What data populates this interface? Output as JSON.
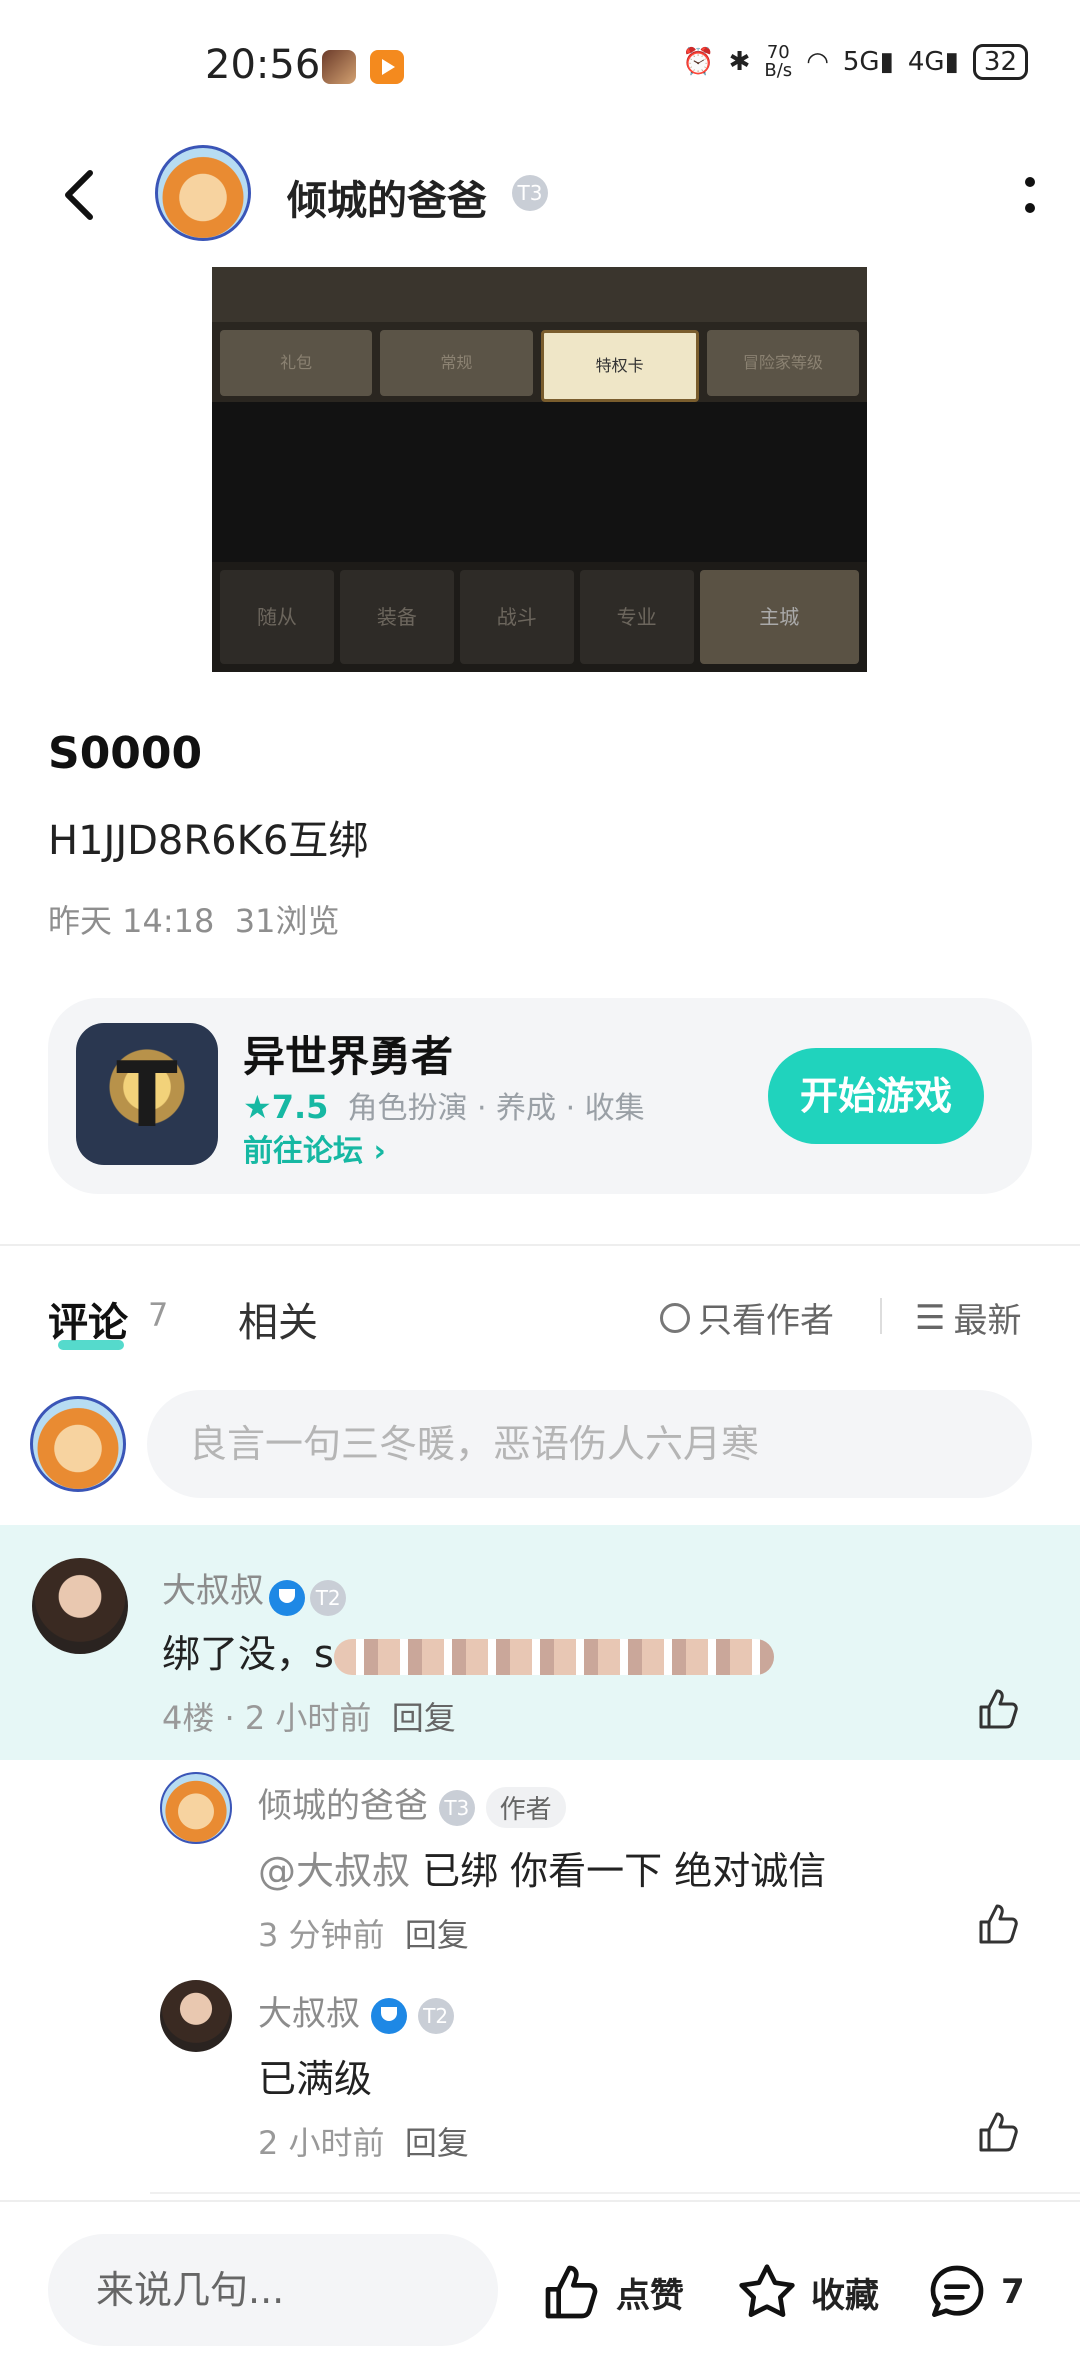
{
  "status": {
    "time": "20:56",
    "speed_top": "70",
    "speed_unit": "B/s",
    "net1": "5G",
    "net2": "4G",
    "battery": "32"
  },
  "header": {
    "username": "倾城的爸爸",
    "level": "T3"
  },
  "image": {
    "tabs": [
      "礼包",
      "常规",
      "特权卡",
      "冒险家等级"
    ],
    "bottom": [
      "随从",
      "装备",
      "战斗",
      "专业",
      "主城"
    ]
  },
  "post": {
    "title": "S0000",
    "content": "H1JJD8R6K6互绑",
    "time": "昨天 14:18",
    "views": "31浏览"
  },
  "game": {
    "name": "异世界勇者",
    "rating": "7.5",
    "tags": "角色扮演 · 养成 · 收集",
    "forum": "前往论坛",
    "play": "开始游戏"
  },
  "comments_tab": {
    "label": "评论",
    "count": "7",
    "related": "相关",
    "only_author": "只看作者",
    "sort": "最新"
  },
  "comment_input": {
    "placeholder": "良言一句三冬暖，恶语伤人六月寒"
  },
  "comment": {
    "name": "大叔叔",
    "level": "T2",
    "text_prefix": "绑了没，s",
    "floor": "4楼",
    "time": "2 小时前",
    "reply": "回复"
  },
  "replies": [
    {
      "name": "倾城的爸爸",
      "level": "T3",
      "tag": "作者",
      "mention": "@大叔叔",
      "text": " 已绑 你看一下 绝对诚信",
      "time": "3 分钟前",
      "reply": "回复"
    },
    {
      "name": "大叔叔",
      "level": "T2",
      "text": "已满级",
      "time": "2 小时前",
      "reply": "回复"
    }
  ],
  "bottom_bar": {
    "placeholder": "来说几句...",
    "like": "点赞",
    "fav": "收藏",
    "comment_count": "7"
  }
}
